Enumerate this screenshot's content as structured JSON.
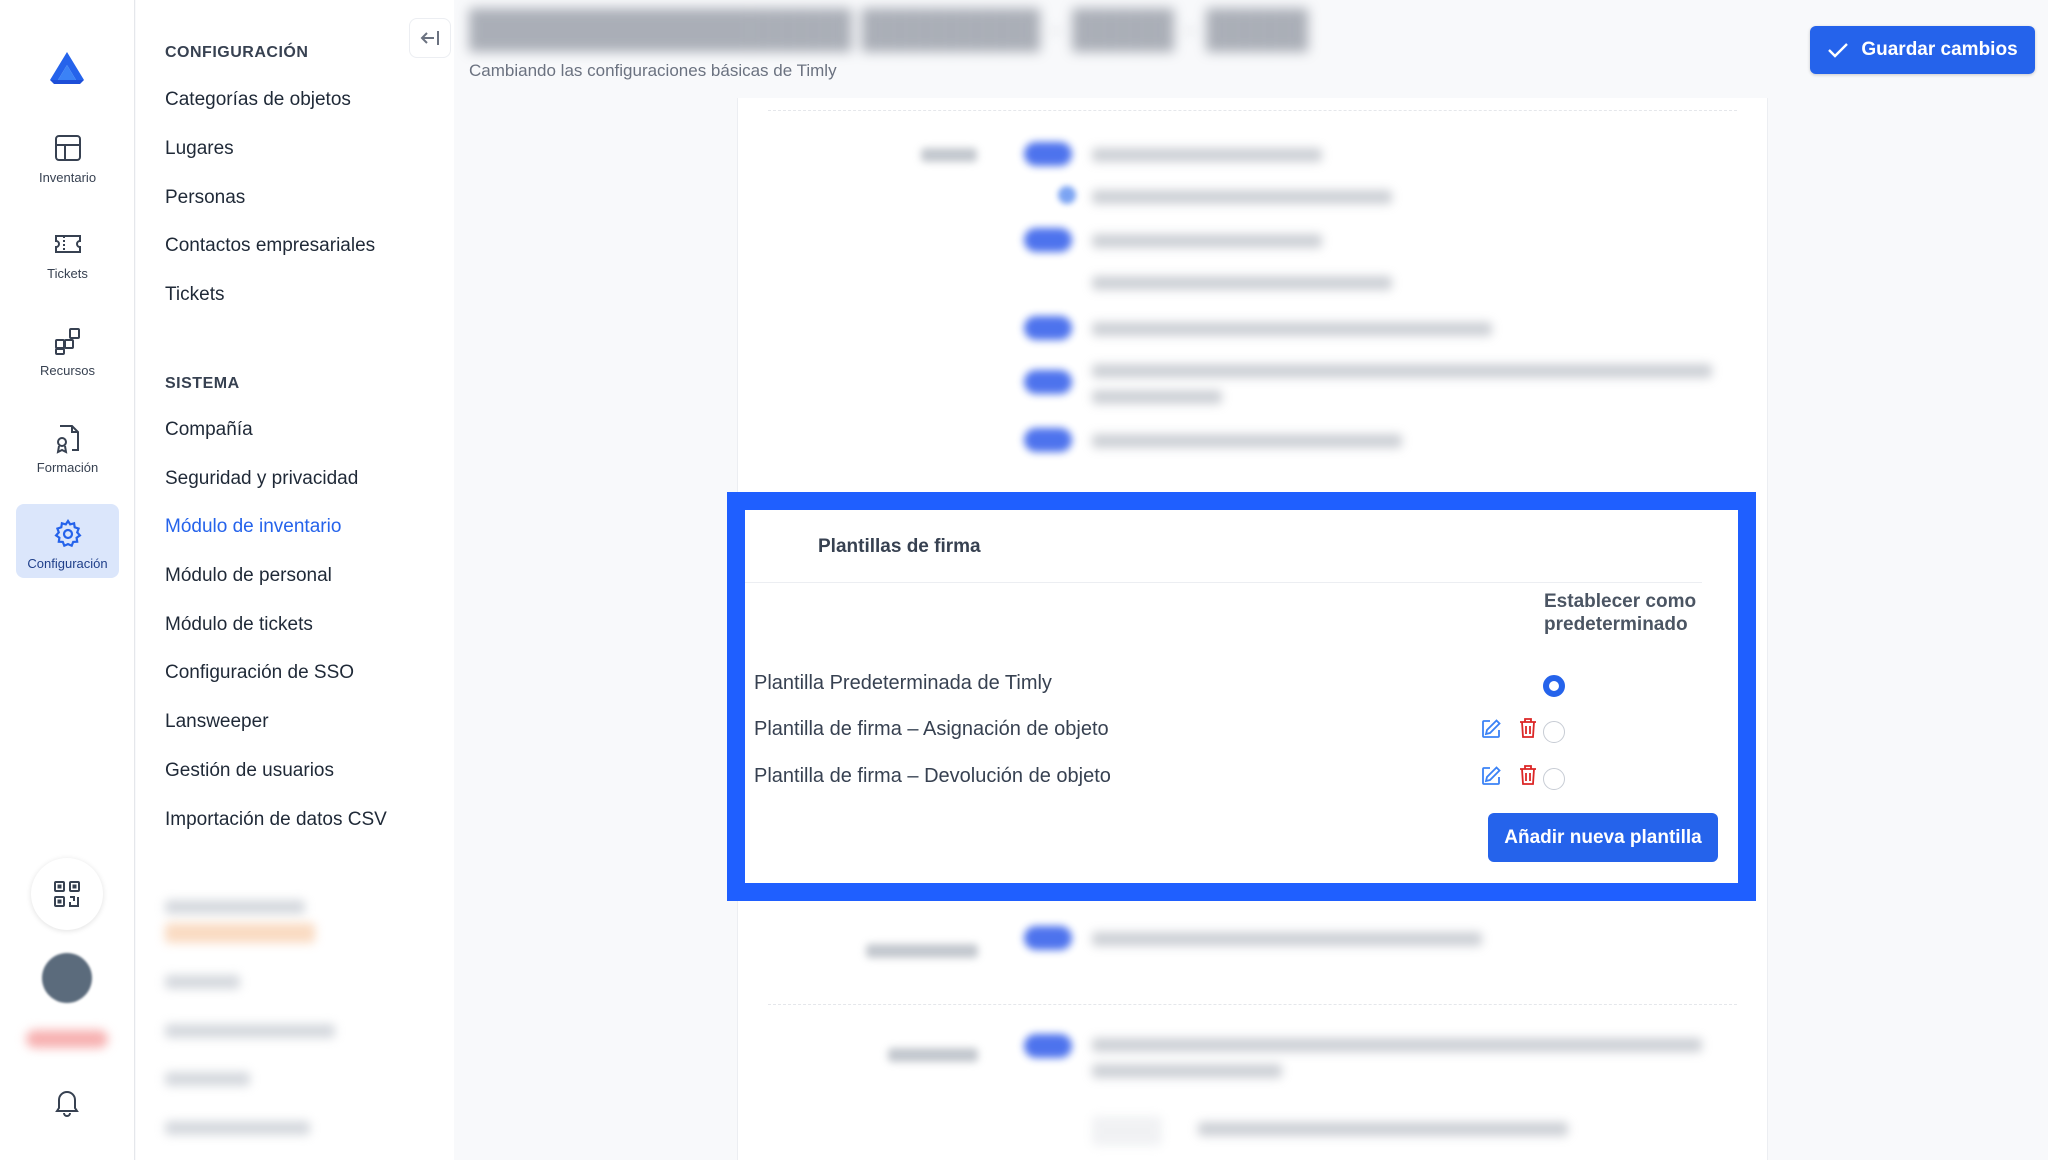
{
  "rail": {
    "items": [
      {
        "label": "Inventario",
        "icon": "grid-icon"
      },
      {
        "label": "Tickets",
        "icon": "ticket-icon"
      },
      {
        "label": "Recursos",
        "icon": "apps-icon"
      },
      {
        "label": "Formación",
        "icon": "certificate-icon"
      },
      {
        "label": "Configuración",
        "icon": "gear-icon",
        "active": true
      }
    ]
  },
  "nav": {
    "section1_heading": "CONFIGURACIÓN",
    "section1_items": [
      "Categorías de objetos",
      "Lugares",
      "Personas",
      "Contactos empresariales",
      "Tickets"
    ],
    "section2_heading": "SISTEMA",
    "section2_items": [
      "Compañía",
      "Seguridad y privacidad",
      "Módulo de inventario",
      "Módulo de personal",
      "Módulo de tickets",
      "Configuración de SSO",
      "Lansweeper",
      "Gestión de usuarios",
      "Importación de datos CSV"
    ],
    "active_item": "Módulo de inventario"
  },
  "header": {
    "subtitle": "Cambiando las configuraciones básicas de Timly",
    "save_label": "Guardar cambios"
  },
  "signature_templates": {
    "title": "Plantillas de firma",
    "default_column_header": "Establecer como predeterminado",
    "templates": [
      {
        "name": "Plantilla Predeterminada de Timly",
        "editable": false,
        "default": true
      },
      {
        "name": "Plantilla de firma – Asignación de objeto",
        "editable": true,
        "default": false
      },
      {
        "name": "Plantilla de firma – Devolución de objeto",
        "editable": true,
        "default": false
      }
    ],
    "add_label": "Añadir nueva plantilla"
  },
  "colors": {
    "primary": "#2563eb",
    "highlight_border": "#1f5fff",
    "delete": "#dc2626",
    "edit": "#3b82f6"
  }
}
